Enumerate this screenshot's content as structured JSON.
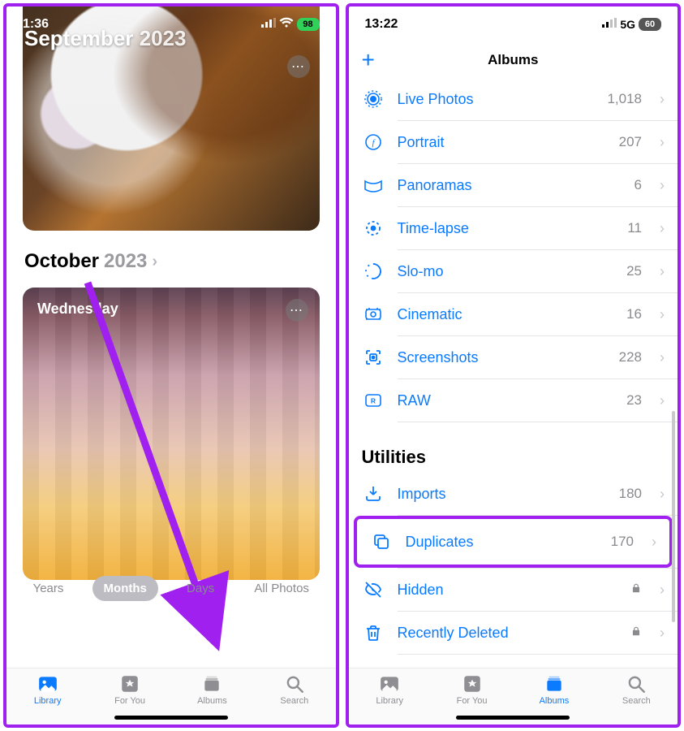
{
  "left": {
    "status": {
      "time": "1:36",
      "battery": "98"
    },
    "header": {
      "month": "September",
      "year": "2023"
    },
    "section": {
      "month": "October",
      "year": "2023"
    },
    "day_card": {
      "day": "Wednesday"
    },
    "segments": {
      "years": "Years",
      "months": "Months",
      "days": "Days",
      "all": "All Photos",
      "active": "Months"
    },
    "tabs": {
      "library": "Library",
      "for_you": "For You",
      "albums": "Albums",
      "search": "Search",
      "active": "Library"
    }
  },
  "right": {
    "status": {
      "time": "13:22",
      "network": "5G",
      "battery": "60"
    },
    "nav": {
      "title": "Albums"
    },
    "media_types": [
      {
        "icon": "live-photos-icon",
        "label": "Live Photos",
        "count": "1,018"
      },
      {
        "icon": "portrait-icon",
        "label": "Portrait",
        "count": "207"
      },
      {
        "icon": "panoramas-icon",
        "label": "Panoramas",
        "count": "6"
      },
      {
        "icon": "timelapse-icon",
        "label": "Time-lapse",
        "count": "11"
      },
      {
        "icon": "slomo-icon",
        "label": "Slo-mo",
        "count": "25"
      },
      {
        "icon": "cinematic-icon",
        "label": "Cinematic",
        "count": "16"
      },
      {
        "icon": "screenshots-icon",
        "label": "Screenshots",
        "count": "228"
      },
      {
        "icon": "raw-icon",
        "label": "RAW",
        "count": "23"
      }
    ],
    "utilities_title": "Utilities",
    "utilities": [
      {
        "icon": "imports-icon",
        "label": "Imports",
        "count": "180",
        "locked": false,
        "highlight": false
      },
      {
        "icon": "duplicates-icon",
        "label": "Duplicates",
        "count": "170",
        "locked": false,
        "highlight": true
      },
      {
        "icon": "hidden-icon",
        "label": "Hidden",
        "count": "",
        "locked": true,
        "highlight": false
      },
      {
        "icon": "recently-deleted-icon",
        "label": "Recently Deleted",
        "count": "",
        "locked": true,
        "highlight": false
      }
    ],
    "tabs": {
      "library": "Library",
      "for_you": "For You",
      "albums": "Albums",
      "search": "Search",
      "active": "Albums"
    }
  }
}
